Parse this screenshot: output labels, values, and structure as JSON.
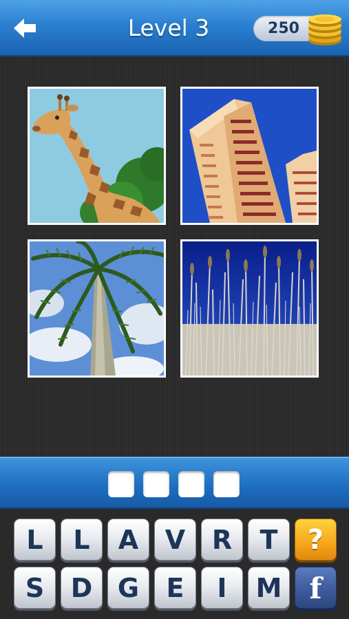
{
  "header": {
    "back_icon": "back-arrow-icon",
    "title": "Level 3",
    "coins": "250",
    "coins_icon": "gold-coins-icon"
  },
  "pictures": [
    {
      "subject": "giraffe"
    },
    {
      "subject": "tall-building"
    },
    {
      "subject": "palm-tree"
    },
    {
      "subject": "reeds"
    }
  ],
  "answer": {
    "slots": [
      "",
      "",
      "",
      ""
    ]
  },
  "keyboard": {
    "row1": [
      "L",
      "L",
      "A",
      "V",
      "R",
      "T"
    ],
    "row2": [
      "S",
      "D",
      "G",
      "E",
      "I",
      "M"
    ],
    "hint_label": "?",
    "share_label": "f"
  },
  "colors": {
    "header_blue": "#2b7fd0",
    "hint_orange": "#f7a51c",
    "facebook_blue": "#3b5998",
    "key_text": "#1d3557"
  }
}
